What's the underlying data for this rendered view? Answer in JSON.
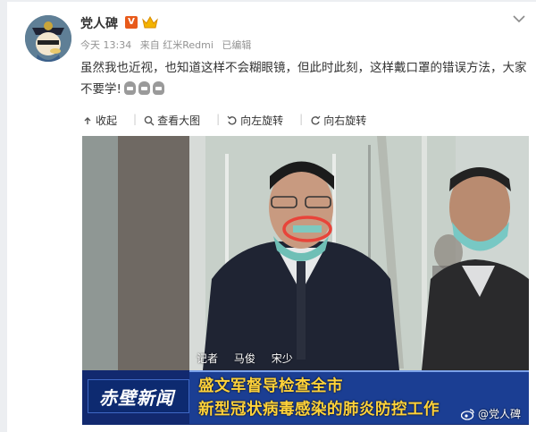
{
  "post": {
    "username": "党人碑",
    "verified_badge": "V",
    "meta": {
      "time": "今天 13:34",
      "source": "来自 红米Redmi",
      "edited": "已编辑"
    },
    "text": "虽然我也近视，也知道这样不会糊眼镜，但此时此刻，这样戴口罩的错误方法，大家不要学!",
    "emoji_count": 3,
    "emoji_name": "face-mask-emoji"
  },
  "toolbar": {
    "collapse": "收起",
    "view_large": "查看大图",
    "rotate_left": "向左旋转",
    "rotate_right": "向右旋转"
  },
  "image": {
    "reporter_label": "记者",
    "reporter_name_1": "马俊",
    "reporter_name_2": "宋少",
    "caption_line_1": "盛文军督导检查全市",
    "caption_line_2": "新型冠状病毒感染的肺炎防控工作",
    "channel_logo": "赤壁新闻",
    "watermark": "@党人碑"
  },
  "colors": {
    "highlight_circle": "#e8443a",
    "caption_text": "#ffd23a",
    "caption_bg": "#14307a",
    "verified_badge": "#e85a1a"
  }
}
